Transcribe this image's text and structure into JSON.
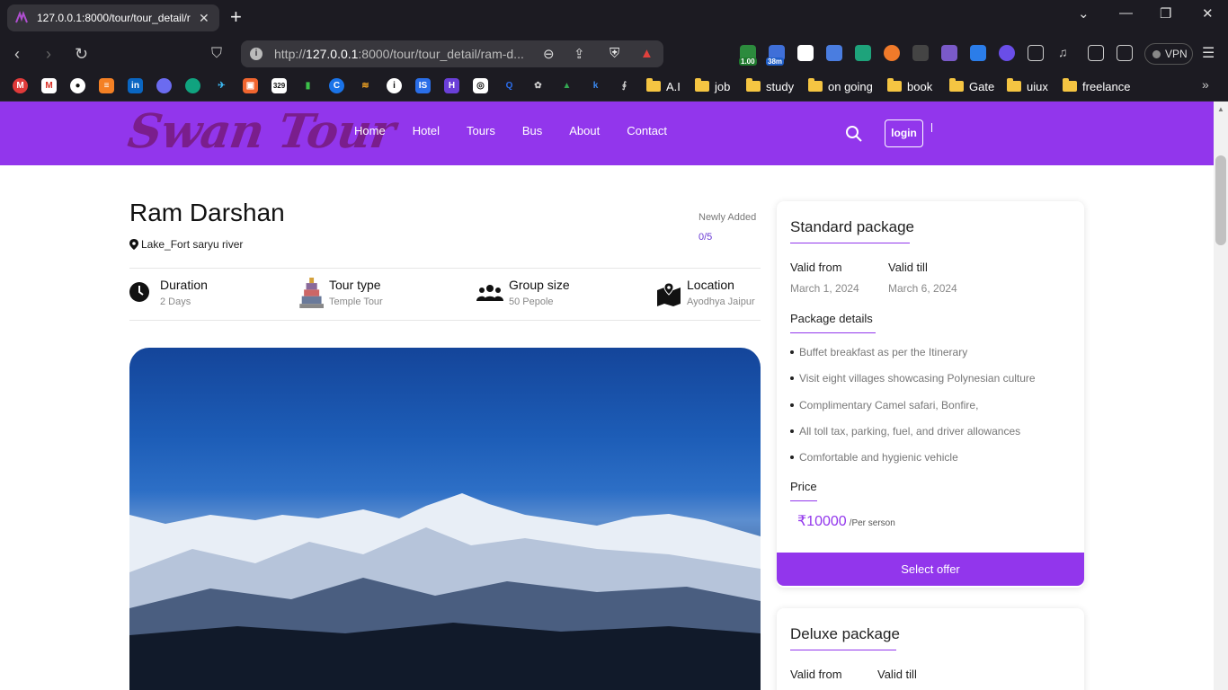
{
  "browser": {
    "tab_title": "127.0.0.1:8000/tour/tour_detail/r",
    "url_prefix": "http://",
    "url_host": "127.0.0.1",
    "url_rest": ":8000/tour/tour_detail/ram-d...",
    "ext_badge_1": "1.00",
    "ext_badge_2": "38m",
    "vpn_label": "VPN",
    "bookmark_folders": [
      "A.I",
      "job",
      "study",
      "on going",
      "book",
      "Gate",
      "uiux",
      "freelance"
    ]
  },
  "site": {
    "logo": "Swan Tour",
    "nav": [
      "Home",
      "Hotel",
      "Tours",
      "Bus",
      "About",
      "Contact"
    ],
    "login": "login"
  },
  "tour": {
    "title": "Ram Darshan",
    "location": "Lake_Fort saryu river",
    "badge": "Newly Added",
    "rating": "0/5",
    "facts": [
      {
        "label": "Duration",
        "value": "2 Days",
        "icon": "clock-icon"
      },
      {
        "label": "Tour type",
        "value": "Temple Tour",
        "icon": "temple-icon"
      },
      {
        "label": "Group size",
        "value": "50 Pepole",
        "icon": "group-icon"
      },
      {
        "label": "Location",
        "value": "Ayodhya Jaipur",
        "icon": "map-icon"
      }
    ]
  },
  "standard": {
    "title": "Standard package",
    "valid_from_label": "Valid from",
    "valid_from": "March 1, 2024",
    "valid_till_label": "Valid till",
    "valid_till": "March 6, 2024",
    "details_title": "Package details",
    "details": [
      "Buffet breakfast as per the Itinerary",
      "Visit eight villages showcasing Polynesian culture",
      "Complimentary Camel safari, Bonfire,",
      "All toll tax, parking, fuel, and driver allowances",
      "Comfortable and hygienic vehicle"
    ],
    "price_title": "Price",
    "price": "₹10000",
    "price_unit": "/Per serson",
    "button": "Select offer"
  },
  "deluxe": {
    "title": "Deluxe package",
    "valid_from_label": "Valid from",
    "valid_till_label": "Valid till"
  },
  "colors": {
    "brand": "#9236ec",
    "logo": "#7a1e8c"
  }
}
